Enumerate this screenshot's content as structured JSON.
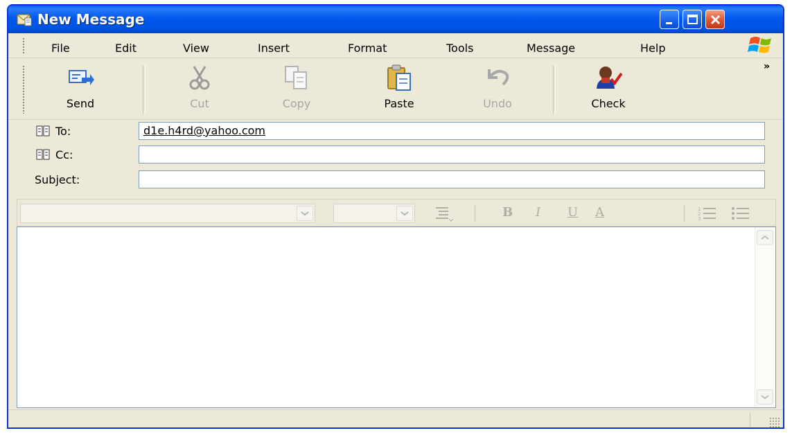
{
  "window": {
    "title": "New Message"
  },
  "menu": [
    "File",
    "Edit",
    "View",
    "Insert",
    "Format",
    "Tools",
    "Message",
    "Help"
  ],
  "toolbar": {
    "send": "Send",
    "cut": "Cut",
    "copy": "Copy",
    "paste": "Paste",
    "undo": "Undo",
    "check": "Check",
    "more": "»"
  },
  "headers": {
    "to_label": "To:",
    "to_value": "d1e.h4rd@yahoo.com",
    "cc_label": "Cc:",
    "cc_value": "",
    "subject_label": "Subject:",
    "subject_value": ""
  },
  "format": {
    "font_name": "",
    "font_size": "",
    "bold": "B",
    "italic": "I",
    "underline": "U",
    "font_color": "A"
  },
  "colors": {
    "titlebar": "#0054e3",
    "chrome": "#ece9d8",
    "close_button": "#e0532e",
    "input_border": "#7f9db9",
    "disabled_text": "#a6a6a6"
  },
  "icons": [
    "app-envelope-icon",
    "minimize-icon",
    "maximize-icon",
    "close-icon",
    "windows-flag-icon",
    "send-icon",
    "scissors-icon",
    "copy-icon",
    "paste-icon",
    "undo-icon",
    "check-spelling-icon",
    "address-book-icon"
  ]
}
